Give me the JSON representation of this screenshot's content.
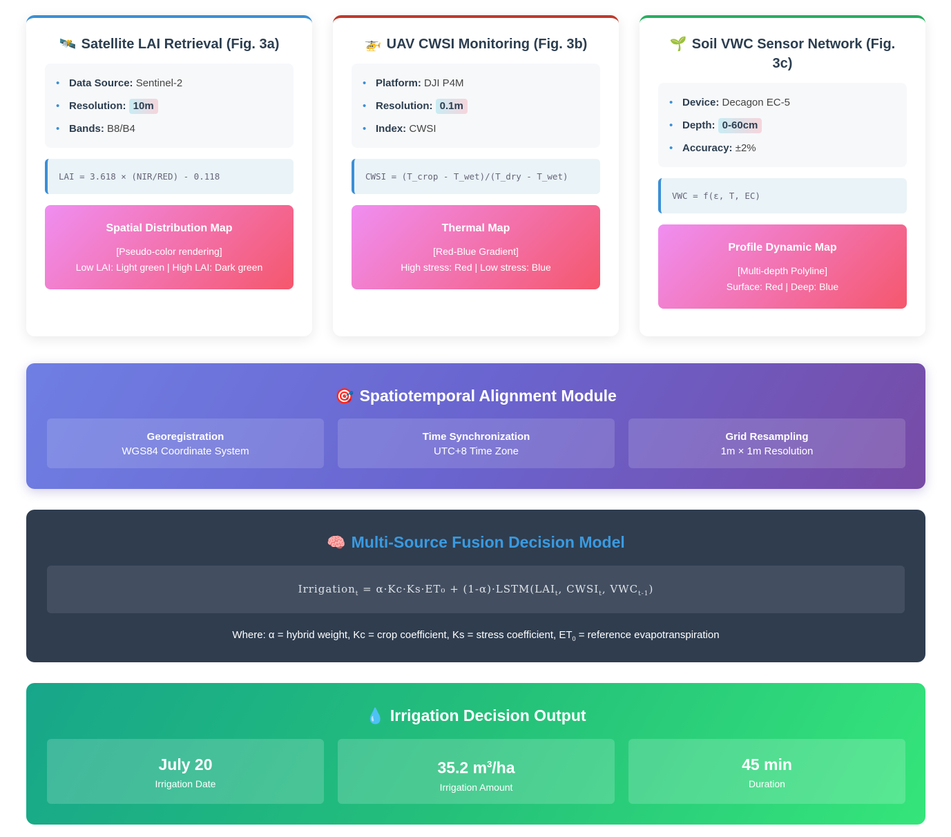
{
  "sources": [
    {
      "icon": "🛰️",
      "icon_name": "satellite-icon",
      "title": "Satellite LAI Retrieval (Fig. 3a)",
      "params": [
        {
          "label": "Data Source:",
          "value": "Sentinel-2",
          "highlight": false
        },
        {
          "label": "Resolution:",
          "value": "10m",
          "highlight": true
        },
        {
          "label": "Bands:",
          "value": "B8/B4",
          "highlight": false
        }
      ],
      "formula": "LAI = 3.618 × (NIR/RED) - 0.118",
      "map_title": "Spatial Distribution Map",
      "map_line1": "[Pseudo-color rendering]",
      "map_line2": "Low LAI: Light green | High LAI: Dark green",
      "accent": "#3a8fd6"
    },
    {
      "icon": "🚁",
      "icon_name": "drone-icon",
      "title": "UAV CWSI Monitoring (Fig. 3b)",
      "params": [
        {
          "label": "Platform:",
          "value": "DJI P4M",
          "highlight": false
        },
        {
          "label": "Resolution:",
          "value": "0.1m",
          "highlight": true
        },
        {
          "label": "Index:",
          "value": "CWSI",
          "highlight": false
        }
      ],
      "formula": "CWSI = (T_crop - T_wet)/(T_dry - T_wet)",
      "map_title": "Thermal Map",
      "map_line1": "[Red-Blue Gradient]",
      "map_line2": "High stress: Red | Low stress: Blue",
      "accent": "#c0392b"
    },
    {
      "icon": "🌱",
      "icon_name": "seedling-icon",
      "title": "Soil VWC Sensor Network (Fig. 3c)",
      "params": [
        {
          "label": "Device:",
          "value": "Decagon EC-5",
          "highlight": false
        },
        {
          "label": "Depth:",
          "value": "0-60cm",
          "highlight": true
        },
        {
          "label": "Accuracy:",
          "value": "±2%",
          "highlight": false
        }
      ],
      "formula": "VWC = f(ε, T, EC)",
      "map_title": "Profile Dynamic Map",
      "map_line1": "[Multi-depth Polyline]",
      "map_line2": "Surface: Red | Deep: Blue",
      "accent": "#27ae60"
    }
  ],
  "alignment": {
    "icon": "🎯",
    "title": "Spatiotemporal Alignment Module",
    "tiles": [
      {
        "title": "Georegistration",
        "desc": "WGS84 Coordinate System"
      },
      {
        "title": "Time Synchronization",
        "desc": "UTC+8 Time Zone"
      },
      {
        "title": "Grid Resampling",
        "desc": "1m × 1m Resolution"
      }
    ]
  },
  "fusion": {
    "icon": "🧠",
    "title": "Multi-Source Fusion Decision Model",
    "equation": {
      "lhs": "Irrigation",
      "lhs_sub": "t",
      "middle": " = α·Kc·Ks·ET₀ + (1-α)·LSTM(LAI",
      "sub1": "t",
      "sep1": ", CWSI",
      "sub2": "t",
      "sep2": ", VWC",
      "sub3": "t-1",
      "end": ")"
    },
    "where_prefix": "Where: α = hybrid weight, Kc = crop coefficient, Ks = stress coefficient, ET",
    "where_sub": "0",
    "where_suffix": " = reference evapotranspiration"
  },
  "output": {
    "icon": "💧",
    "title": "Irrigation Decision Output",
    "tiles": [
      {
        "value": "July 20",
        "sup": "",
        "suffix": "",
        "label": "Irrigation Date"
      },
      {
        "value": "35.2 m",
        "sup": "3",
        "suffix": "/ha",
        "label": "Irrigation Amount"
      },
      {
        "value": "45 min",
        "sup": "",
        "suffix": "",
        "label": "Duration"
      }
    ]
  }
}
